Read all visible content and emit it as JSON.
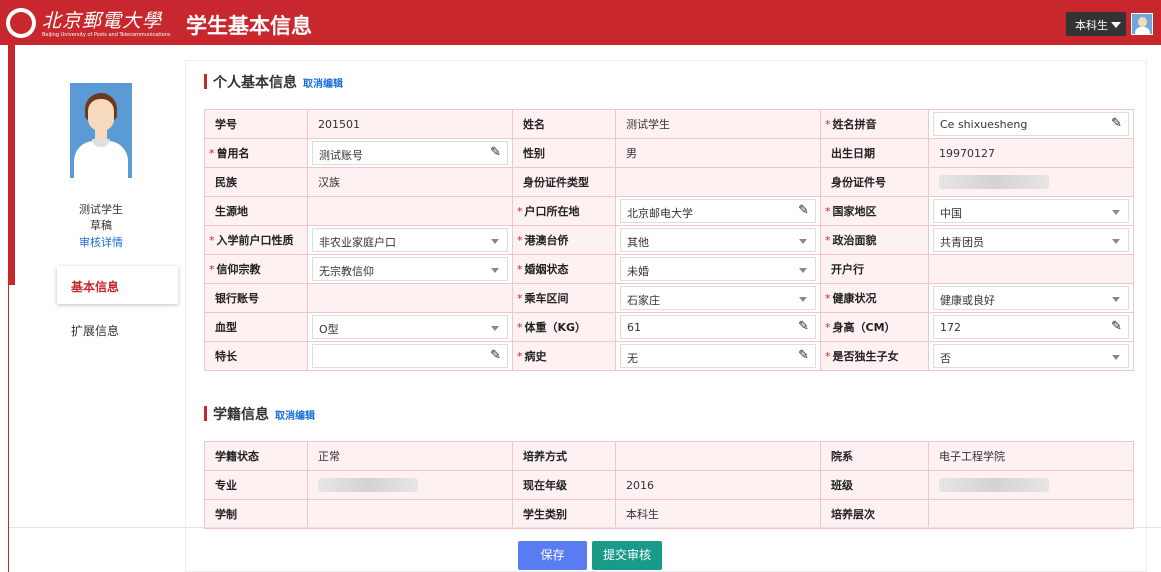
{
  "header": {
    "logo_cn": "北京郵電大學",
    "logo_en": "Beijing University of Posts and Telecommunications",
    "title": "学生基本信息",
    "role": "本科生"
  },
  "sidebar": {
    "student_name": "测试学生",
    "status": "草稿",
    "review_link": "审核详情",
    "nav_basic": "基本信息",
    "nav_extended": "扩展信息"
  },
  "personal": {
    "title": "个人基本信息",
    "edit_link": "取消编辑",
    "rows": [
      [
        {
          "label": "学号",
          "value": "201501"
        },
        {
          "label": "姓名",
          "value": "测试学生"
        },
        {
          "label": "姓名拼音",
          "value": "Ce shixuesheng",
          "req": true,
          "ctl": "text"
        }
      ],
      [
        {
          "label": "曾用名",
          "value": "测试账号",
          "req": true,
          "ctl": "text"
        },
        {
          "label": "性别",
          "value": "男"
        },
        {
          "label": "出生日期",
          "value": "19970127"
        }
      ],
      [
        {
          "label": "民族",
          "value": "汉族"
        },
        {
          "label": "身份证件类型",
          "value": ""
        },
        {
          "label": "身份证件号",
          "value": "",
          "blur": true
        }
      ],
      [
        {
          "label": "生源地",
          "value": ""
        },
        {
          "label": "户口所在地",
          "value": "北京邮电大学",
          "req": true,
          "ctl": "text"
        },
        {
          "label": "国家地区",
          "value": "中国",
          "req": true,
          "ctl": "select"
        }
      ],
      [
        {
          "label": "入学前户口性质",
          "value": "非农业家庭户口",
          "req": true,
          "ctl": "select"
        },
        {
          "label": "港澳台侨",
          "value": "其他",
          "req": true,
          "ctl": "select"
        },
        {
          "label": "政治面貌",
          "value": "共青团员",
          "req": true,
          "ctl": "select"
        }
      ],
      [
        {
          "label": "信仰宗教",
          "value": "无宗教信仰",
          "req": true,
          "ctl": "select"
        },
        {
          "label": "婚姻状态",
          "value": "未婚",
          "req": true,
          "ctl": "select"
        },
        {
          "label": "开户行",
          "value": ""
        }
      ],
      [
        {
          "label": "银行账号",
          "value": ""
        },
        {
          "label": "乘车区间",
          "value": "石家庄",
          "req": true,
          "ctl": "select"
        },
        {
          "label": "健康状况",
          "value": "健康或良好",
          "req": true,
          "ctl": "select"
        }
      ],
      [
        {
          "label": "血型",
          "value": "O型",
          "ctl": "select"
        },
        {
          "label": "体重（KG）",
          "value": "61",
          "req": true,
          "ctl": "text"
        },
        {
          "label": "身高（CM）",
          "value": "172",
          "req": true,
          "ctl": "text"
        }
      ],
      [
        {
          "label": "特长",
          "value": "",
          "ctl": "text"
        },
        {
          "label": "病史",
          "value": "无",
          "req": true,
          "ctl": "text"
        },
        {
          "label": "是否独生子女",
          "value": "否",
          "req": true,
          "ctl": "select"
        }
      ]
    ]
  },
  "enrollment": {
    "title": "学籍信息",
    "edit_link": "取消编辑",
    "rows": [
      [
        {
          "label": "学籍状态",
          "value": "正常"
        },
        {
          "label": "培养方式",
          "value": ""
        },
        {
          "label": "院系",
          "value": "电子工程学院"
        }
      ],
      [
        {
          "label": "专业",
          "value": "",
          "blur": true
        },
        {
          "label": "现在年级",
          "value": "2016"
        },
        {
          "label": "班级",
          "value": "",
          "blur": true
        }
      ],
      [
        {
          "label": "学制",
          "value": ""
        },
        {
          "label": "学生类别",
          "value": "本科生"
        },
        {
          "label": "培养层次",
          "value": ""
        }
      ]
    ]
  },
  "actions": {
    "save": "保存",
    "submit": "提交审核"
  }
}
